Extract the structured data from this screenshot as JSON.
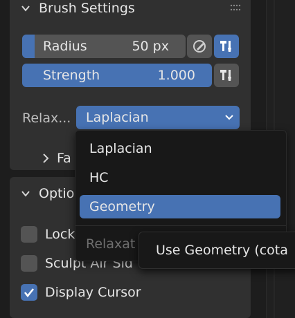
{
  "brush_settings": {
    "title": "Brush Settings",
    "radius": {
      "label": "Radius",
      "value": "50 px"
    },
    "strength": {
      "label": "Strength",
      "value": "1.000"
    },
    "relax": {
      "label": "Relax...",
      "value": "Laplacian"
    },
    "falloff_label": "Fa"
  },
  "options": {
    "title": "Optio",
    "lock_label": "Lock",
    "sculpt_label": "Sculpt Air Sid",
    "display_cursor_label": "Display Cursor",
    "display_cursor_checked": true
  },
  "relax_menu": {
    "items": [
      "Laplacian",
      "HC",
      "Geometry"
    ],
    "selected": "Geometry",
    "description": "Relaxat"
  },
  "tooltip": {
    "text": "Use Geometry (cota"
  },
  "colors": {
    "accent": "#4772b3",
    "panel": "#303030",
    "field": "#545454",
    "menu": "#181818"
  },
  "icons": [
    "chevron-down-icon",
    "drag-grip-icon",
    "pressure-pen-icon",
    "pin-icon",
    "chevron-right-icon",
    "checkmark-icon"
  ]
}
